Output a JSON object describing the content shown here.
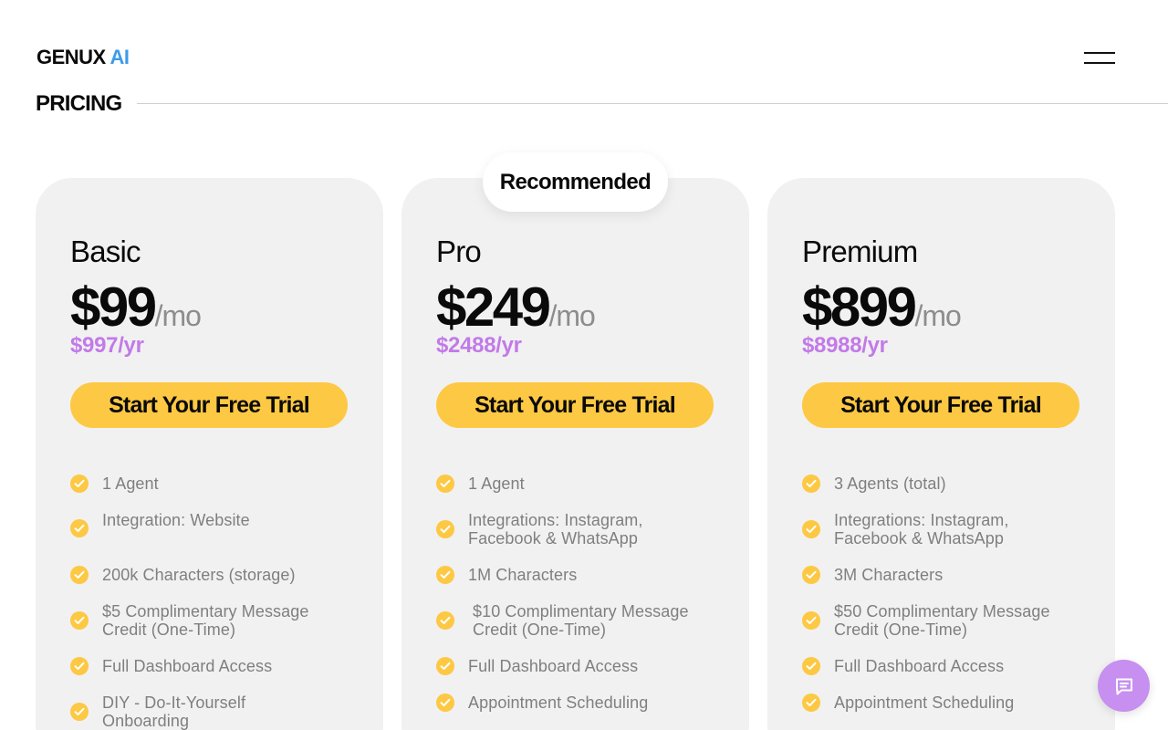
{
  "brand": {
    "name": "GENUX",
    "suffix": "AI",
    "accent": "#3d9be9"
  },
  "section": {
    "title": "PRICING"
  },
  "badge": {
    "label": "Recommended"
  },
  "colors": {
    "cta": "#fdc843",
    "yearly": "#c27ae8",
    "card": "#f1f1f1",
    "chat": "#c68ff0"
  },
  "icons": {
    "menu": "hamburger-icon",
    "check": "check-circle-icon",
    "chat": "chat-icon"
  },
  "plans": [
    {
      "name": "Basic",
      "price": "$99",
      "per": "/mo",
      "yearly": "$997/yr",
      "cta": "Start Your Free Trial",
      "features": [
        "1 Agent",
        "Integration: Website",
        "200k Characters (storage)",
        "$5 Complimentary Message Credit (One-Time)",
        "Full Dashboard Access",
        "DIY - Do-It-Yourself Onboarding"
      ]
    },
    {
      "name": "Pro",
      "price": "$249",
      "per": "/mo",
      "yearly": "$2488/yr",
      "cta": "Start Your Free Trial",
      "features": [
        "1 Agent",
        "Integrations: Instagram, Facebook & WhatsApp",
        "1M Characters",
        "$10 Complimentary Message Credit (One-Time)",
        "Full Dashboard Access",
        "Appointment Scheduling"
      ]
    },
    {
      "name": "Premium",
      "price": "$899",
      "per": "/mo",
      "yearly": "$8988/yr",
      "cta": "Start Your Free Trial",
      "features": [
        "3 Agents (total)",
        "Integrations: Instagram, Facebook & WhatsApp",
        "3M Characters",
        "$50 Complimentary Message Credit (One-Time)",
        "Full Dashboard Access",
        "Appointment Scheduling"
      ]
    }
  ]
}
